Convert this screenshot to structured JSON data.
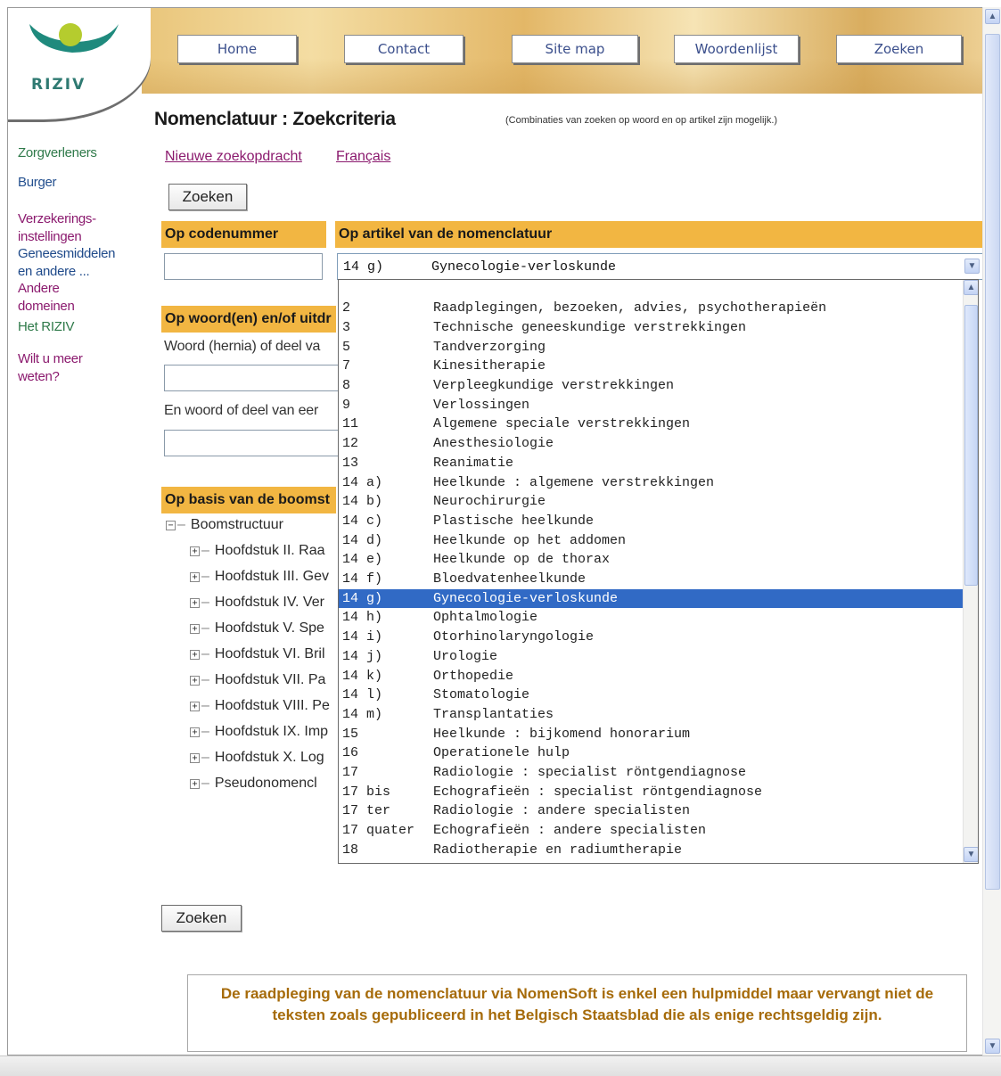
{
  "logo": {
    "text": "RIZIV"
  },
  "nav": {
    "items": [
      "Home",
      "Contact",
      "Site map",
      "Woordenlijst",
      "Zoeken"
    ]
  },
  "left_nav": {
    "items": [
      "Zorgverleners",
      "Burger",
      "Verzekerings-",
      "instellingen",
      "Geneesmiddelen",
      "en andere ...",
      "Andere",
      "domeinen",
      "Het RIZIV",
      "Wilt u meer",
      "weten?"
    ]
  },
  "main": {
    "title": "Nomenclatuur : Zoekcriteria",
    "combination_note": "(Combinaties van zoeken op woord en op artikel zijn mogelijk.)",
    "new_search_link": "Nieuwe zoekopdracht",
    "french_link": "Français",
    "search_button": "Zoeken",
    "search_button_bottom": "Zoeken",
    "code_section": {
      "heading": "Op codenummer",
      "value": ""
    },
    "article_section": {
      "heading": "Op artikel van de nomenclatuur",
      "selected_value": "14 g)      Gynecologie-verloskunde"
    },
    "word_section": {
      "heading": "Op woord(en) en/of uitdr",
      "label1": "Woord (hernia) of deel va",
      "label2": "En woord of deel van eer",
      "value1": "",
      "value2": ""
    },
    "tree_section": {
      "heading": "Op basis van de boomst",
      "root": "Boomstructuur",
      "items": [
        "Hoofdstuk II. Raa",
        "Hoofdstuk III. Gev",
        "Hoofdstuk IV. Ver",
        "Hoofdstuk V. Spe",
        "Hoofdstuk VI. Bril",
        "Hoofdstuk VII. Pa",
        "Hoofdstuk VIII. Pe",
        "Hoofdstuk IX. Imp",
        "Hoofdstuk X. Log",
        "Pseudonomencl"
      ]
    }
  },
  "dropdown": {
    "selected_index": 15,
    "options": [
      {
        "code": "",
        "label": ""
      },
      {
        "code": "2",
        "label": "Raadplegingen, bezoeken, advies, psychotherapieën"
      },
      {
        "code": "3",
        "label": "Technische geneeskundige verstrekkingen"
      },
      {
        "code": "5",
        "label": "Tandverzorging"
      },
      {
        "code": "7",
        "label": "Kinesitherapie"
      },
      {
        "code": "8",
        "label": "Verpleegkundige verstrekkingen"
      },
      {
        "code": "9",
        "label": "Verlossingen"
      },
      {
        "code": "11",
        "label": "Algemene speciale verstrekkingen"
      },
      {
        "code": "12",
        "label": "Anesthesiologie"
      },
      {
        "code": "13",
        "label": "Reanimatie"
      },
      {
        "code": "14 a)",
        "label": "Heelkunde : algemene verstrekkingen"
      },
      {
        "code": "14 b)",
        "label": "Neurochirurgie"
      },
      {
        "code": "14 c)",
        "label": "Plastische heelkunde"
      },
      {
        "code": "14 d)",
        "label": "Heelkunde op het addomen"
      },
      {
        "code": "14 e)",
        "label": "Heelkunde op de thorax"
      },
      {
        "code": "14 f)",
        "label": "Bloedvatenheelkunde"
      },
      {
        "code": "14 g)",
        "label": "Gynecologie-verloskunde"
      },
      {
        "code": "14 h)",
        "label": "Ophtalmologie"
      },
      {
        "code": "14 i)",
        "label": "Otorhinolaryngologie"
      },
      {
        "code": "14 j)",
        "label": "Urologie"
      },
      {
        "code": "14 k)",
        "label": "Orthopedie"
      },
      {
        "code": "14 l)",
        "label": "Stomatologie"
      },
      {
        "code": "14 m)",
        "label": "Transplantaties"
      },
      {
        "code": "15",
        "label": "Heelkunde : bijkomend honorarium"
      },
      {
        "code": "16",
        "label": "Operationele hulp"
      },
      {
        "code": "17",
        "label": "Radiologie : specialist röntgendiagnose"
      },
      {
        "code": "17 bis",
        "label": "Echografieën : specialist röntgendiagnose"
      },
      {
        "code": "17 ter",
        "label": "Radiologie : andere specialisten"
      },
      {
        "code": "17 quater",
        "label": "Echografieën : andere specialisten"
      },
      {
        "code": "18",
        "label": "Radiotherapie en radiumtherapie"
      }
    ]
  },
  "disclaimer": {
    "text": "De raadpleging van de nomenclatuur via NomenSoft is enkel een hulpmiddel maar vervangt niet de teksten zoals gepubliceerd in het Belgisch Staatsblad die als enige rechtsgeldig zijn."
  },
  "colors": {
    "section_header": "#f2b642",
    "link_purple": "#8b1a6e",
    "nav_link_green": "#2f7a4a",
    "selected_option": "#316ac5",
    "disclaimer_text": "#a66b0a"
  },
  "icons": {
    "select_arrow": "chevron-down-icon",
    "tree_expand": "plus-box-icon",
    "tree_collapse": "minus-box-icon"
  }
}
